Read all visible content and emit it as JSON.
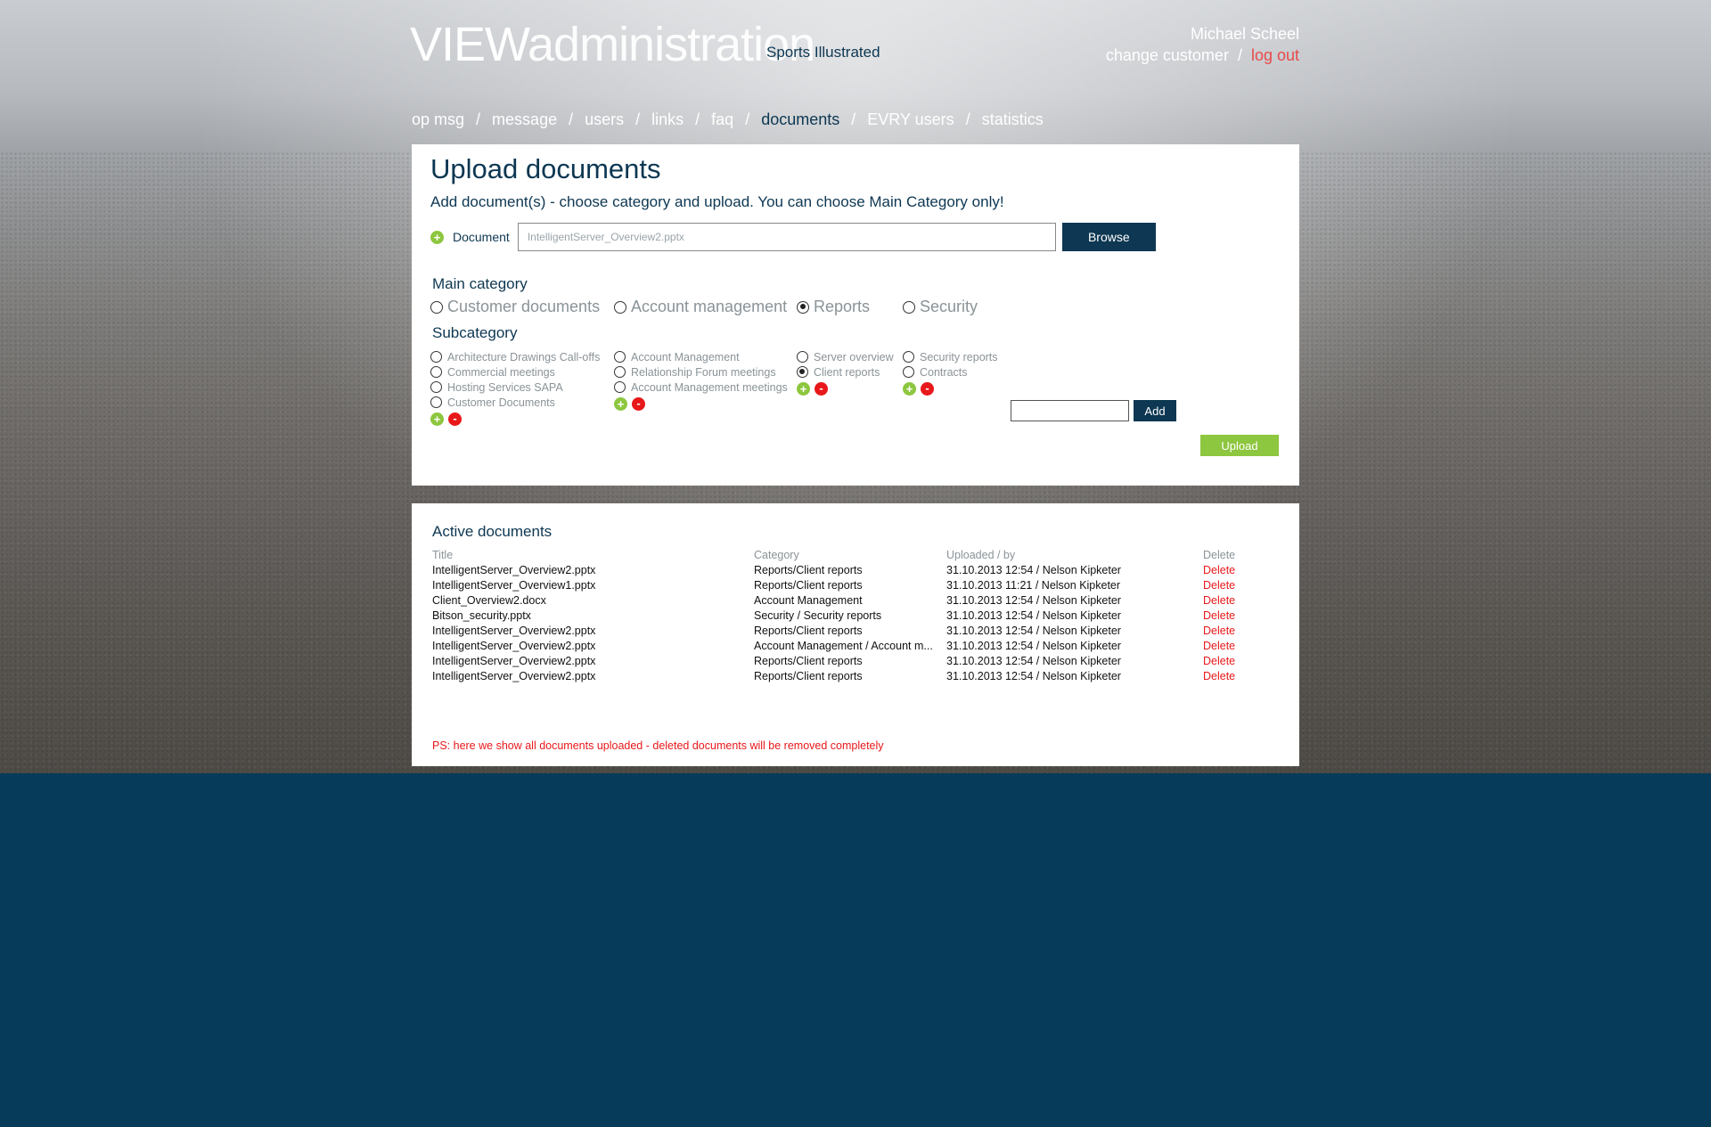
{
  "brand": {
    "bold": "VIEW",
    "light": "administration"
  },
  "customer_name": "Sports Illustrated",
  "user": {
    "name": "Michael Scheel",
    "change_customer": "change customer",
    "separator": "/",
    "logout": "log out"
  },
  "nav": {
    "separator": "/",
    "items": [
      {
        "label": "op msg",
        "active": false
      },
      {
        "label": "message",
        "active": false
      },
      {
        "label": "users",
        "active": false
      },
      {
        "label": "links",
        "active": false
      },
      {
        "label": "faq",
        "active": false
      },
      {
        "label": "documents",
        "active": true
      },
      {
        "label": "EVRY users",
        "active": false
      },
      {
        "label": "statistics",
        "active": false
      }
    ]
  },
  "upload": {
    "title": "Upload documents",
    "lead": "Add document(s) - choose category and upload. You can choose Main Category only!",
    "plus": "+",
    "minus": "-",
    "document_label": "Document",
    "document_value": "IntelligentServer_Overview2.pptx",
    "browse": "Browse",
    "main_category_title": "Main category",
    "main_categories": [
      {
        "label": "Customer documents",
        "selected": false
      },
      {
        "label": "Account management",
        "selected": false
      },
      {
        "label": "Reports",
        "selected": true
      },
      {
        "label": "Security",
        "selected": false
      }
    ],
    "subcategory_title": "Subcategory",
    "subcategories": [
      {
        "items": [
          {
            "label": "Architecture Drawings Call-offs",
            "selected": false
          },
          {
            "label": "Commercial meetings",
            "selected": false
          },
          {
            "label": "Hosting Services SAPA",
            "selected": false
          },
          {
            "label": "Customer Documents",
            "selected": false
          }
        ]
      },
      {
        "items": [
          {
            "label": "Account Management",
            "selected": false
          },
          {
            "label": "Relationship Forum meetings",
            "selected": false
          },
          {
            "label": "Account Management meetings",
            "selected": false
          }
        ]
      },
      {
        "items": [
          {
            "label": "Server overview",
            "selected": false
          },
          {
            "label": "Client reports",
            "selected": true
          }
        ]
      },
      {
        "items": [
          {
            "label": "Security reports",
            "selected": false
          },
          {
            "label": "Contracts",
            "selected": false
          }
        ]
      }
    ],
    "add_value": "",
    "add_button": "Add",
    "upload_button": "Upload"
  },
  "active": {
    "title": "Active documents",
    "headers": [
      "Title",
      "Category",
      "Uploaded / by",
      "Delete"
    ],
    "rows": [
      [
        "IntelligentServer_Overview2.pptx",
        "Reports/Client reports",
        "31.10.2013  12:54 / Nelson Kipketer",
        "Delete"
      ],
      [
        "IntelligentServer_Overview1.pptx",
        "Reports/Client reports",
        "31.10.2013  11:21 / Nelson Kipketer",
        "Delete"
      ],
      [
        "Client_Overview2.docx",
        "Account Management",
        "31.10.2013  12:54 / Nelson Kipketer",
        "Delete"
      ],
      [
        "Bitson_security.pptx",
        "Security / Security reports",
        "31.10.2013  12:54 / Nelson Kipketer",
        "Delete"
      ],
      [
        "IntelligentServer_Overview2.pptx",
        "Reports/Client reports",
        "31.10.2013  12:54 / Nelson Kipketer",
        "Delete"
      ],
      [
        "IntelligentServer_Overview2.pptx",
        "Account Management / Account m...",
        "31.10.2013  12:54 / Nelson Kipketer",
        "Delete"
      ],
      [
        "IntelligentServer_Overview2.pptx",
        "Reports/Client reports",
        "31.10.2013  12:54 / Nelson Kipketer",
        "Delete"
      ],
      [
        "IntelligentServer_Overview2.pptx",
        "Reports/Client reports",
        "31.10.2013  12:54 / Nelson Kipketer",
        "Delete"
      ]
    ],
    "note": "PS: here we show all documents uploaded - deleted documents will be removed completely"
  },
  "colors": {
    "brand_dark": "#0d3752",
    "accent_green": "#8dc63f",
    "danger_red": "#e8181a",
    "page_bottom": "#063b59"
  }
}
